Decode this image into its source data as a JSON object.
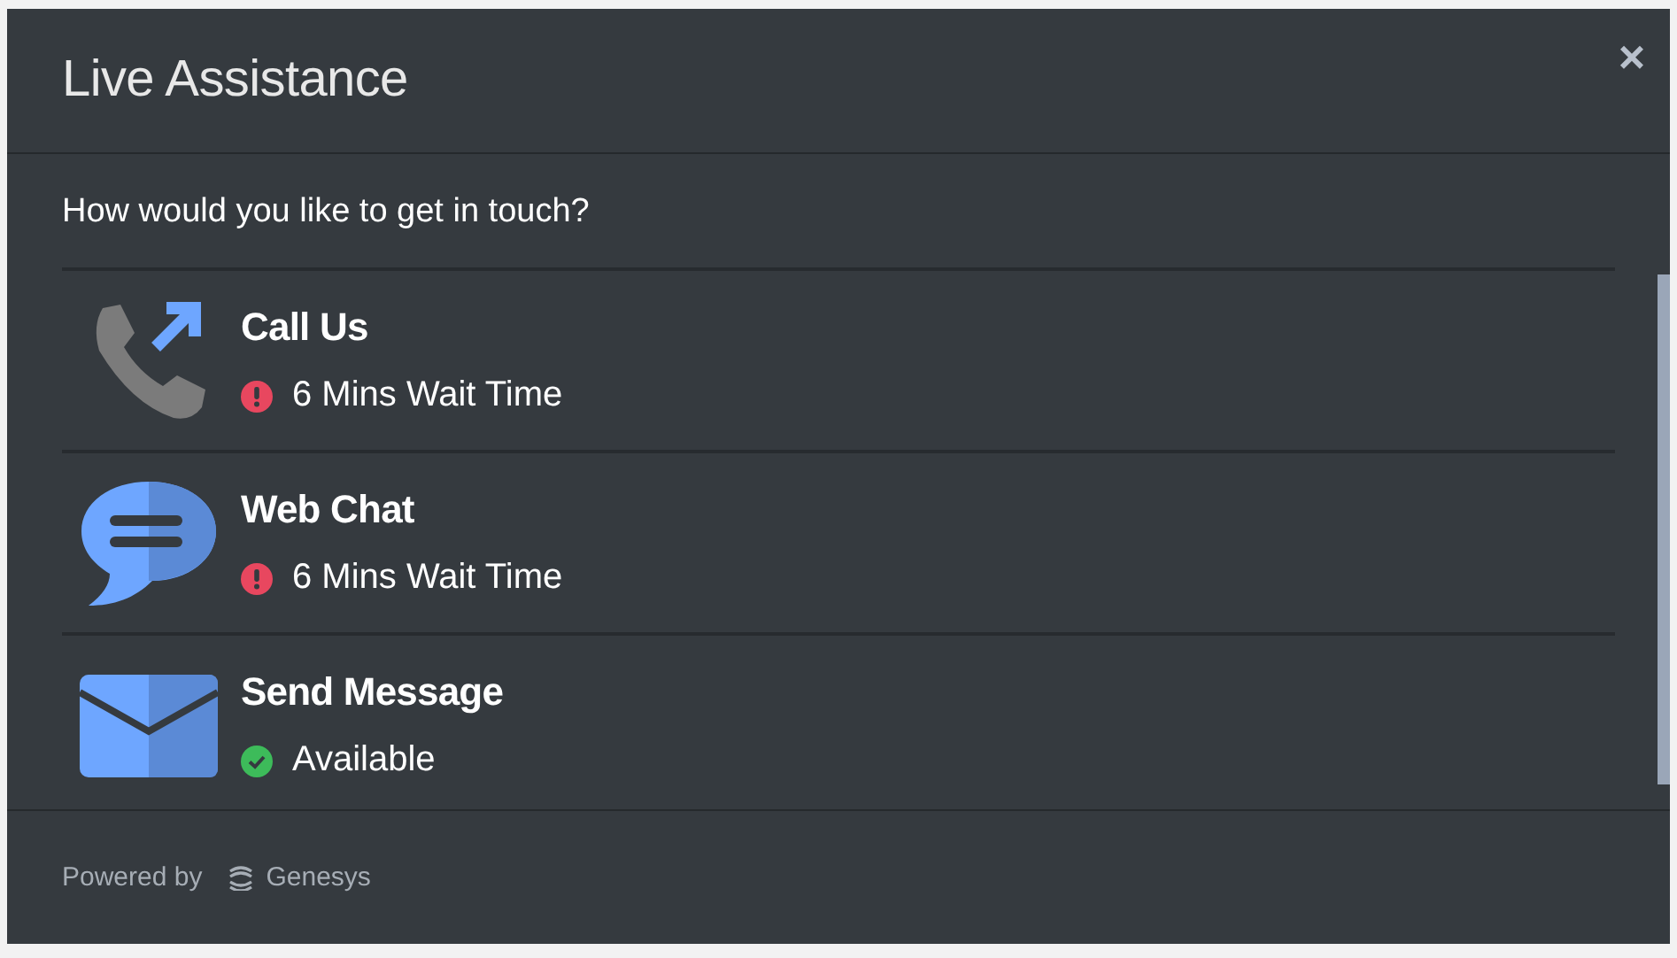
{
  "window": {
    "title": "Live Assistance",
    "close": "×"
  },
  "prompt": "How would you like to get in touch?",
  "channels": [
    {
      "kind": "call",
      "name": "Call Us",
      "status": {
        "kind": "wait",
        "text": "6 Mins Wait Time"
      }
    },
    {
      "kind": "chat",
      "name": "Web Chat",
      "status": {
        "kind": "wait",
        "text": "6 Mins Wait Time"
      }
    },
    {
      "kind": "email",
      "name": "Send Message",
      "status": {
        "kind": "available",
        "text": "Available"
      }
    }
  ],
  "footer": {
    "powered_by": "Powered by",
    "brand": "Genesys"
  }
}
